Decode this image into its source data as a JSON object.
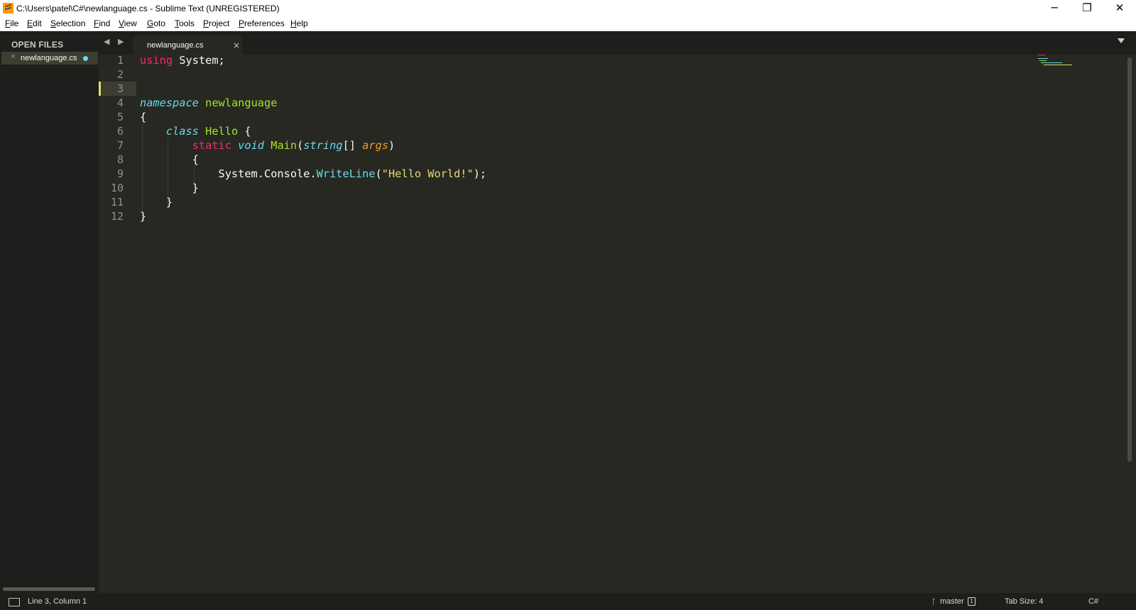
{
  "window": {
    "title": "C:\\Users\\patel\\C#\\newlanguage.cs - Sublime Text (UNREGISTERED)",
    "controls": {
      "minimize": "─",
      "maximize": "❐",
      "close": "✕"
    }
  },
  "menu": [
    "File",
    "Edit",
    "Selection",
    "Find",
    "View",
    "Goto",
    "Tools",
    "Project",
    "Preferences",
    "Help"
  ],
  "sidebar": {
    "title": "OPEN FILES",
    "files": [
      {
        "name": "newlanguage.cs",
        "close": "×",
        "modified": true
      }
    ]
  },
  "tabs": {
    "nav": "◀ ▶",
    "items": [
      {
        "label": "newlanguage.cs",
        "close": "×"
      }
    ]
  },
  "editor": {
    "line_numbers": [
      "1",
      "2",
      "3",
      "4",
      "5",
      "6",
      "7",
      "8",
      "9",
      "10",
      "11",
      "12"
    ],
    "current_line": 3,
    "lines": [
      [
        {
          "t": "using",
          "c": "kw"
        },
        {
          "t": " System;",
          "c": ""
        }
      ],
      [],
      [],
      [
        {
          "t": "namespace",
          "c": "st"
        },
        {
          "t": " ",
          "c": ""
        },
        {
          "t": "newlanguage",
          "c": "en"
        }
      ],
      [
        {
          "t": "{",
          "c": ""
        }
      ],
      [
        {
          "t": "    ",
          "c": ""
        },
        {
          "t": "class",
          "c": "st"
        },
        {
          "t": " ",
          "c": ""
        },
        {
          "t": "Hello",
          "c": "en"
        },
        {
          "t": " {",
          "c": ""
        }
      ],
      [
        {
          "t": "        ",
          "c": ""
        },
        {
          "t": "static",
          "c": "kw"
        },
        {
          "t": " ",
          "c": ""
        },
        {
          "t": "void",
          "c": "st"
        },
        {
          "t": " ",
          "c": ""
        },
        {
          "t": "Main",
          "c": "fn"
        },
        {
          "t": "(",
          "c": ""
        },
        {
          "t": "string",
          "c": "st"
        },
        {
          "t": "[] ",
          "c": ""
        },
        {
          "t": "args",
          "c": "pm"
        },
        {
          "t": ")",
          "c": ""
        }
      ],
      [
        {
          "t": "        {",
          "c": ""
        }
      ],
      [
        {
          "t": "            System.Console.",
          "c": ""
        },
        {
          "t": "WriteLine",
          "c": "sp"
        },
        {
          "t": "(",
          "c": ""
        },
        {
          "t": "\"Hello World!\"",
          "c": "str"
        },
        {
          "t": ");",
          "c": ""
        }
      ],
      [
        {
          "t": "        }",
          "c": ""
        }
      ],
      [
        {
          "t": "    }",
          "c": ""
        }
      ],
      [
        {
          "t": "}",
          "c": ""
        }
      ]
    ]
  },
  "colors": {
    "background": "#272822",
    "keyword": "#f92672",
    "storage": "#66d9ef",
    "entity": "#a6e22e",
    "string": "#e6db74",
    "parameter": "#fd971f"
  },
  "status": {
    "position": "Line 3, Column 1",
    "branch": "master",
    "branch_badge": "1",
    "tab_size": "Tab Size: 4",
    "syntax": "C#"
  }
}
